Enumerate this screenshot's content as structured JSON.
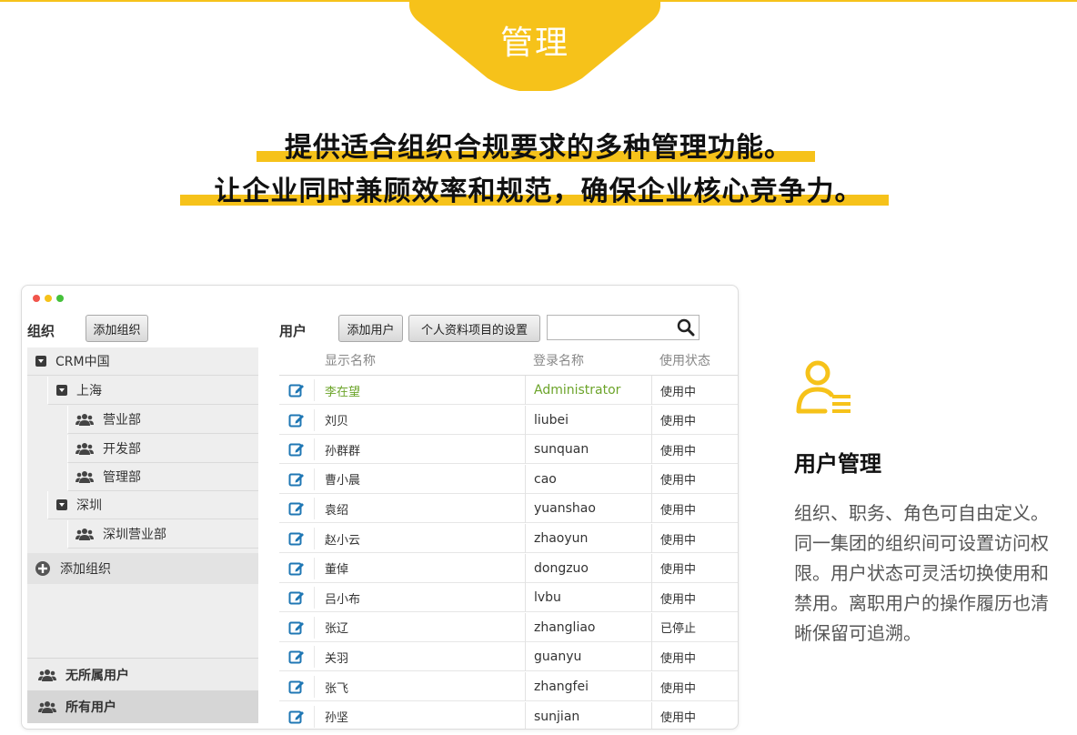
{
  "banner": {
    "title": "管理"
  },
  "headline": {
    "line1": "提供适合组织合规要求的多种管理功能。",
    "line2": "让企业同时兼顾效率和规范，确保企业核心竞争力。"
  },
  "colors": {
    "accent": "#f6c21a",
    "highlight_text": "#6ca42a"
  },
  "app": {
    "org_label": "组织",
    "add_org_button": "添加组织",
    "user_label": "用户",
    "add_user_button": "添加用户",
    "profile_settings_button": "个人资料项目的设置",
    "search": {
      "value": "",
      "icon": "search-icon"
    },
    "tree": [
      {
        "label": "CRM中国",
        "icon": "collapse-icon",
        "level": 0
      },
      {
        "label": "上海",
        "icon": "collapse-icon",
        "level": 1
      },
      {
        "label": "营业部",
        "icon": "group-icon",
        "level": 2
      },
      {
        "label": "开发部",
        "icon": "group-icon",
        "level": 2
      },
      {
        "label": "管理部",
        "icon": "group-icon",
        "level": 2
      },
      {
        "label": "深圳",
        "icon": "collapse-icon",
        "level": 1
      },
      {
        "label": "深圳营业部",
        "icon": "group-icon",
        "level": 2
      }
    ],
    "tree_add_org": "添加组织",
    "unassigned_users": "无所属用户",
    "all_users": "所有用户",
    "columns": {
      "display_name": "显示名称",
      "login_name": "登录名称",
      "status": "使用状态"
    },
    "users": [
      {
        "name": "李在望",
        "login": "Administrator",
        "status": "使用中",
        "highlighted": true
      },
      {
        "name": "刘贝",
        "login": "liubei",
        "status": "使用中"
      },
      {
        "name": "孙群群",
        "login": "sunquan",
        "status": "使用中"
      },
      {
        "name": "曹小晨",
        "login": "cao",
        "status": "使用中"
      },
      {
        "name": "袁绍",
        "login": "yuanshao",
        "status": "使用中"
      },
      {
        "name": "赵小云",
        "login": "zhaoyun",
        "status": "使用中"
      },
      {
        "name": "董倬",
        "login": "dongzuo",
        "status": "使用中"
      },
      {
        "name": "吕小布",
        "login": "lvbu",
        "status": "使用中"
      },
      {
        "name": "张辽",
        "login": "zhangliao",
        "status": "已停止"
      },
      {
        "name": "关羽",
        "login": "guanyu",
        "status": "使用中"
      },
      {
        "name": "张飞",
        "login": "zhangfei",
        "status": "使用中"
      },
      {
        "name": "孙坚",
        "login": "sunjian",
        "status": "使用中"
      }
    ]
  },
  "feature": {
    "icon": "user-list-icon",
    "title": "用户管理",
    "description": "组织、职务、角色可自由定义。同一集团的组织间可设置访问权限。用户状态可灵活切换使用和禁用。离职用户的操作履历也清晰保留可追溯。"
  }
}
